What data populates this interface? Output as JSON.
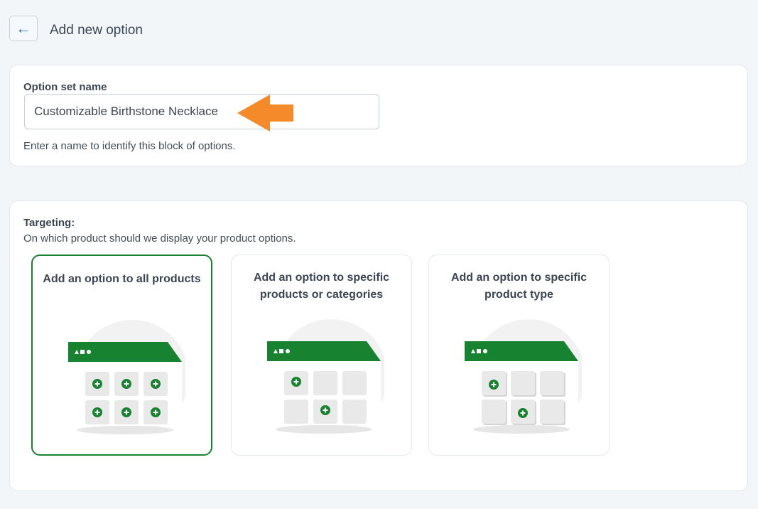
{
  "header": {
    "back_icon": "←",
    "title": "Add new option"
  },
  "option_set": {
    "label": "Option set name",
    "value": "Customizable Birthstone Necklace",
    "help": "Enter a name to identify this block of options.",
    "arrow_color": "#f58a2a"
  },
  "targeting": {
    "label": "Targeting:",
    "description": "On which product should we display your product options.",
    "options": [
      {
        "title": "Add an option to all products",
        "selected": true
      },
      {
        "title": "Add an option to specific products or categories",
        "selected": false
      },
      {
        "title": "Add an option to specific product type",
        "selected": false
      }
    ]
  },
  "colors": {
    "brand_green": "#17822f",
    "selected_border": "#17822f",
    "page_bg": "#f3f6f9"
  }
}
